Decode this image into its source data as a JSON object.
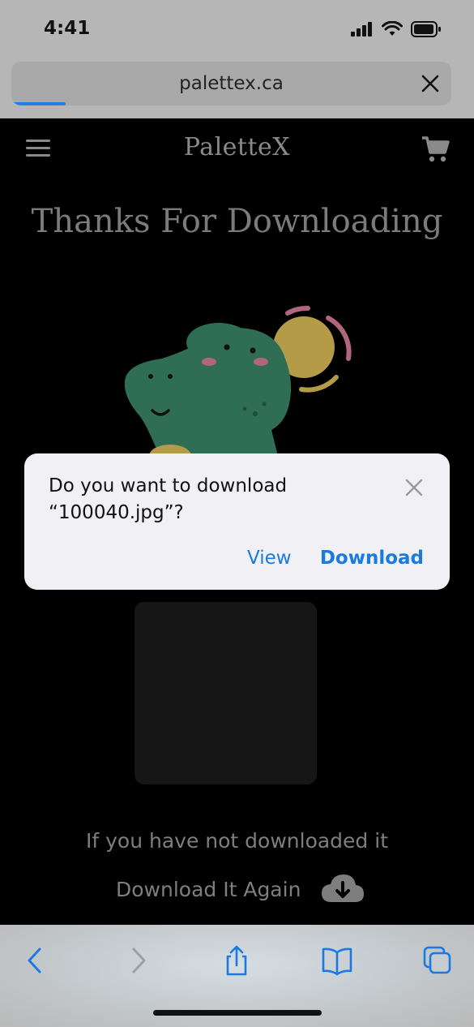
{
  "status_bar": {
    "time": "4:41"
  },
  "browser": {
    "url": "palettex.ca"
  },
  "site": {
    "logo": "PaletteX",
    "title": "Thanks For Downloading",
    "note": "If you have not downloaded it",
    "download_again": "Download It Again"
  },
  "dialog": {
    "message_line1": "Do you want to download",
    "message_line2": "“100040.jpg”?",
    "view_label": "View",
    "download_label": "Download"
  },
  "colors": {
    "accent": "#1a7ae0",
    "dino": "#2f6e55",
    "sun": "#b39b47",
    "blush": "#b0677d"
  }
}
